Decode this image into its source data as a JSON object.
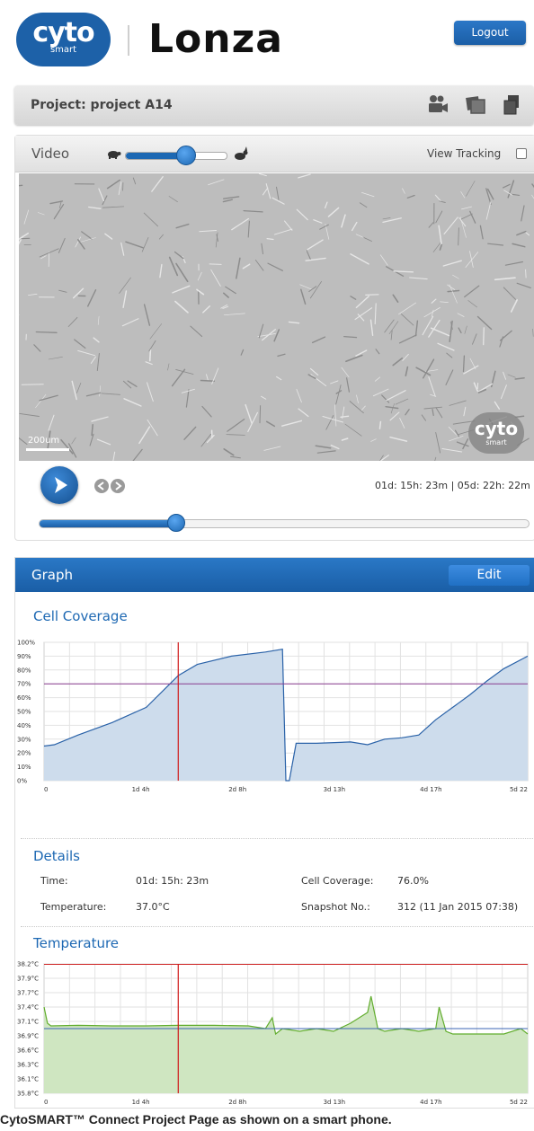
{
  "header": {
    "logo_cyto": "cyto",
    "logo_cyto_sub": "smart",
    "logo_lonza": "Lonza",
    "logout_label": "Logout"
  },
  "project": {
    "title": "Project: project A14",
    "icons": [
      "video-camera-icon",
      "gallery-icon",
      "export-icon"
    ]
  },
  "video": {
    "title": "Video",
    "view_tracking_label": "View Tracking",
    "scale_label": "200um",
    "watermark": "cyto",
    "watermark_sub": "smart",
    "time_readout": "01d: 15h: 23m | 05d: 22h: 22m",
    "speed_level": 0.6,
    "progress": 0.28
  },
  "graph": {
    "title": "Graph",
    "edit_label": "Edit"
  },
  "details": {
    "title": "Details",
    "time_label": "Time:",
    "time_value": "01d: 15h: 23m",
    "temperature_label": "Temperature:",
    "temperature_value": "37.0°C",
    "coverage_label": "Cell Coverage:",
    "coverage_value": "76.0%",
    "snapshot_label": "Snapshot No.:",
    "snapshot_value": "312 (11 Jan 2015 07:38)"
  },
  "caption": "CytoSMART™ Connect Project Page as shown on a smart phone.",
  "chart_data": [
    {
      "type": "area",
      "title": "Cell Coverage",
      "x_ticks": [
        "0",
        "1d 4h",
        "2d 8h",
        "3d 13h",
        "4d 17h",
        "5d 22"
      ],
      "y_ticks": [
        "0%",
        "10%",
        "20%",
        "30%",
        "40%",
        "50%",
        "60%",
        "70%",
        "80%",
        "90%",
        "100%"
      ],
      "ylim": [
        0,
        100
      ],
      "xlim_hours": [
        0,
        142
      ],
      "threshold": 70,
      "cursor_hours": 39.4,
      "x_hours": [
        0,
        3,
        10,
        20,
        30,
        39.4,
        45,
        55,
        65,
        70,
        71,
        72,
        74,
        75,
        80,
        90,
        95,
        100,
        105,
        110,
        115,
        120,
        125,
        130,
        135,
        142
      ],
      "y": [
        25,
        26,
        33,
        42,
        53,
        76,
        84,
        90,
        93,
        95,
        0,
        0,
        27,
        27,
        27,
        28,
        26,
        30,
        31,
        33,
        44,
        53,
        62,
        72,
        81,
        90
      ],
      "color_fill": "#cddcec",
      "color_line": "#2a62a8",
      "color_threshold": "#8a3d8f",
      "color_cursor": "#d0191a"
    },
    {
      "type": "area",
      "title": "Temperature",
      "x_ticks": [
        "0",
        "1d 4h",
        "2d 8h",
        "3d 13h",
        "4d 17h",
        "5d 22"
      ],
      "y_ticks": [
        "35.8°C",
        "36.1°C",
        "36.3°C",
        "36.6°C",
        "36.9°C",
        "37.1°C",
        "37.4°C",
        "37.7°C",
        "37.9°C",
        "38.2°C"
      ],
      "ylim": [
        35.8,
        38.2
      ],
      "xlim_hours": [
        0,
        142
      ],
      "cursor_hours": 39.4,
      "upper_limit": 38.2,
      "reference": 37.0,
      "x_hours": [
        0,
        1,
        2,
        10,
        20,
        30,
        39.4,
        50,
        60,
        65,
        67,
        68,
        70,
        75,
        80,
        85,
        90,
        95,
        96,
        98,
        100,
        105,
        110,
        115,
        116,
        118,
        120,
        125,
        130,
        135,
        140,
        142
      ],
      "y": [
        37.4,
        37.1,
        37.05,
        37.06,
        37.05,
        37.05,
        37.06,
        37.06,
        37.05,
        37.0,
        37.2,
        36.9,
        37.0,
        36.95,
        37.0,
        36.95,
        37.1,
        37.3,
        37.6,
        37.0,
        36.95,
        37.0,
        36.95,
        37.0,
        37.4,
        36.95,
        36.9,
        36.9,
        36.9,
        36.9,
        37.0,
        36.9
      ],
      "color_fill": "#cfe6c1",
      "color_line": "#62ad2e",
      "color_reference": "#3b64b5",
      "color_limit": "#cf2a2a",
      "color_cursor": "#d0191a"
    }
  ]
}
